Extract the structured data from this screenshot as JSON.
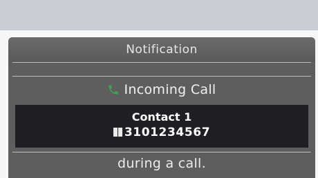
{
  "notification": {
    "title": "Notification",
    "incoming_label": "Incoming Call",
    "incoming_icon": "phone-handset-icon",
    "icon_color": "#3fa34d",
    "contact": {
      "name": "Contact 1",
      "number": "3101234567",
      "number_icon": "phone-number-icon"
    },
    "footer": "during a call."
  }
}
